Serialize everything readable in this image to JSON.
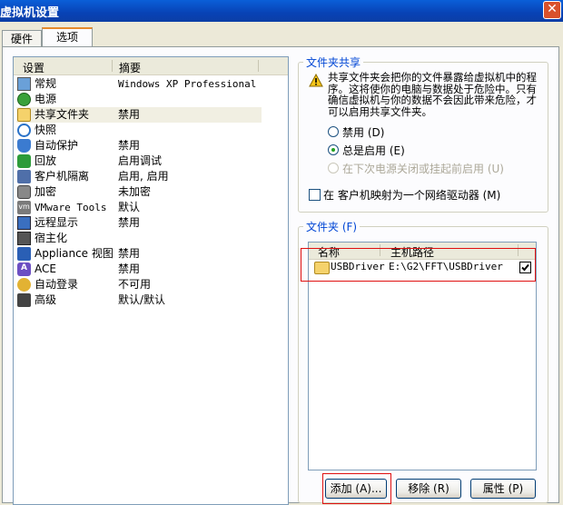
{
  "window": {
    "title": "虚拟机设置",
    "close_label": "✕"
  },
  "tabs": [
    {
      "label": "硬件"
    },
    {
      "label": "选项"
    }
  ],
  "settings_list": {
    "col_setting": "设置",
    "col_summary": "摘要",
    "items": [
      {
        "icon": "general-monitor-icon",
        "label": "常规",
        "summary": "Windows XP Professional"
      },
      {
        "icon": "power-icon",
        "label": "电源",
        "summary": ""
      },
      {
        "icon": "folder-icon",
        "label": "共享文件夹",
        "summary": "禁用"
      },
      {
        "icon": "snapshot-icon",
        "label": "快照",
        "summary": ""
      },
      {
        "icon": "autoprotect-icon",
        "label": "自动保护",
        "summary": "禁用"
      },
      {
        "icon": "replay-icon",
        "label": "回放",
        "summary": "启用调试"
      },
      {
        "icon": "guest-isolation-icon",
        "label": "客户机隔离",
        "summary": "启用, 启用"
      },
      {
        "icon": "encryption-icon",
        "label": "加密",
        "summary": "未加密"
      },
      {
        "icon": "vmware-tools-icon",
        "label": "VMware Tools",
        "summary": "默认"
      },
      {
        "icon": "remote-display-icon",
        "label": "远程显示",
        "summary": "禁用"
      },
      {
        "icon": "unity-host-icon",
        "label": "宿主化",
        "summary": ""
      },
      {
        "icon": "appliance-view-icon",
        "label": "Appliance 视图",
        "summary": "禁用"
      },
      {
        "icon": "ace-icon",
        "label": "ACE",
        "summary": "禁用"
      },
      {
        "icon": "autologin-icon",
        "label": "自动登录",
        "summary": "不可用"
      },
      {
        "icon": "advanced-icon",
        "label": "高级",
        "summary": "默认/默认"
      }
    ],
    "selected_index": 2
  },
  "sharing": {
    "group_title": "文件夹共享",
    "warning_icon": "warning-icon",
    "warning_text": "共享文件夹会把你的文件暴露给虚拟机中的程序。这将使你的电脑与数据处于危险中。只有确信虚拟机与你的数据不会因此带来危险，才可以启用共享文件夹。",
    "options": [
      {
        "label": "禁用 (D)",
        "checked": false,
        "enabled": true
      },
      {
        "label": "总是启用 (E)",
        "checked": true,
        "enabled": true
      },
      {
        "label": "在下次电源关闭或挂起前启用 (U)",
        "checked": false,
        "enabled": false
      }
    ],
    "map_drive_label": "在 客户机映射为一个网络驱动器 (M)",
    "map_drive_checked": false
  },
  "folders": {
    "group_title": "文件夹 (F)",
    "col_name": "名称",
    "col_path": "主机路径",
    "rows": [
      {
        "icon": "folder-icon",
        "name": "USBDriver",
        "path": "E:\\G2\\FFT\\USBDriver",
        "enabled": true
      }
    ]
  },
  "buttons": {
    "add": "添加 (A)...",
    "remove": "移除 (R)",
    "properties": "属性 (P)"
  }
}
